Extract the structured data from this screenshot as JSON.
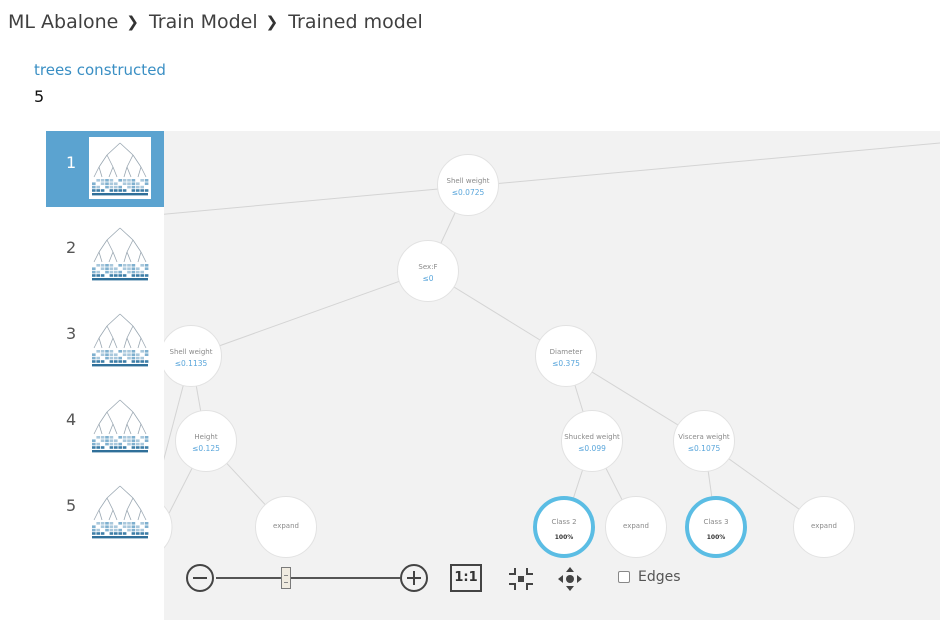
{
  "breadcrumb": [
    {
      "label": "ML Abalone"
    },
    {
      "label": "Train Model"
    },
    {
      "label": "Trained model"
    }
  ],
  "separator_icon": "chevron-right-icon",
  "stats": {
    "label": "trees constructed",
    "value": "5"
  },
  "trees": [
    {
      "number": "1",
      "selected": true
    },
    {
      "number": "2",
      "selected": false
    },
    {
      "number": "3",
      "selected": false
    },
    {
      "number": "4",
      "selected": false
    },
    {
      "number": "5",
      "selected": false
    }
  ],
  "nodes": [
    {
      "name": "Shell weight",
      "cond": "≤0.0725"
    },
    {
      "name": "Sex:F",
      "cond": "≤0"
    },
    {
      "name": "Shell weight",
      "cond": "≤0.1135"
    },
    {
      "name": "Diameter",
      "cond": "≤0.375"
    },
    {
      "name": "Height",
      "cond": "≤0.125"
    },
    {
      "name": "Shucked weight",
      "cond": "≤0.099"
    },
    {
      "name": "Viscera weight",
      "cond": "≤0.1075"
    },
    {
      "name": "expand"
    },
    {
      "name": "Class 2",
      "pct": "100%"
    },
    {
      "name": "expand"
    },
    {
      "name": "Class 3",
      "pct": "100%"
    },
    {
      "name": "expand"
    }
  ],
  "toolbar": {
    "zoom_out_icon": "zoom-out-icon",
    "zoom_in_icon": "zoom-in-icon",
    "actual_size_label": "1:1",
    "fit_icon": "fit-to-screen-icon",
    "pan_icon": "pan-icon",
    "edges_label": "Edges",
    "edges_checked": false,
    "zoom_level": 0.38
  },
  "colors": {
    "accent": "#5ba3d0",
    "leaf_ring": "#5bbde4",
    "link": "#3a8fc4",
    "condition": "#5aa6db",
    "canvas_bg": "#f2f2f2"
  }
}
